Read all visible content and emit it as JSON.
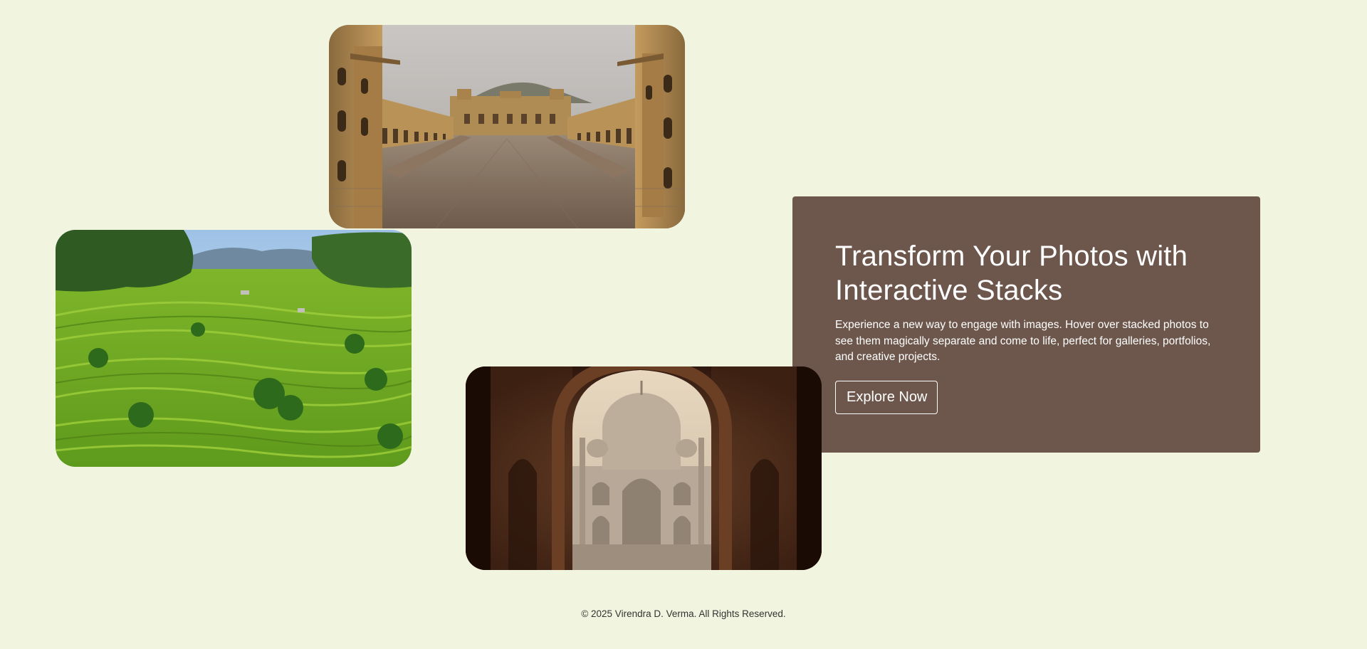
{
  "hero": {
    "title_line1": "Transform Your Photos with",
    "title_line2": "Interactive Stacks",
    "description": "Experience a new way to engage with images. Hover over stacked photos to see them magically separate and come to life, perfect for galleries, portfolios, and creative projects.",
    "button_label": "Explore Now"
  },
  "footer": {
    "copyright": "© 2025 Virendra D. Verma. All Rights Reserved."
  },
  "colors": {
    "page_background": "#f1f5df",
    "card_background": "#6d574c",
    "card_text": "#ffffff"
  },
  "photos": [
    {
      "name": "fort-courtyard-photo"
    },
    {
      "name": "rice-terraces-photo"
    },
    {
      "name": "taj-mahal-arch-photo"
    }
  ]
}
